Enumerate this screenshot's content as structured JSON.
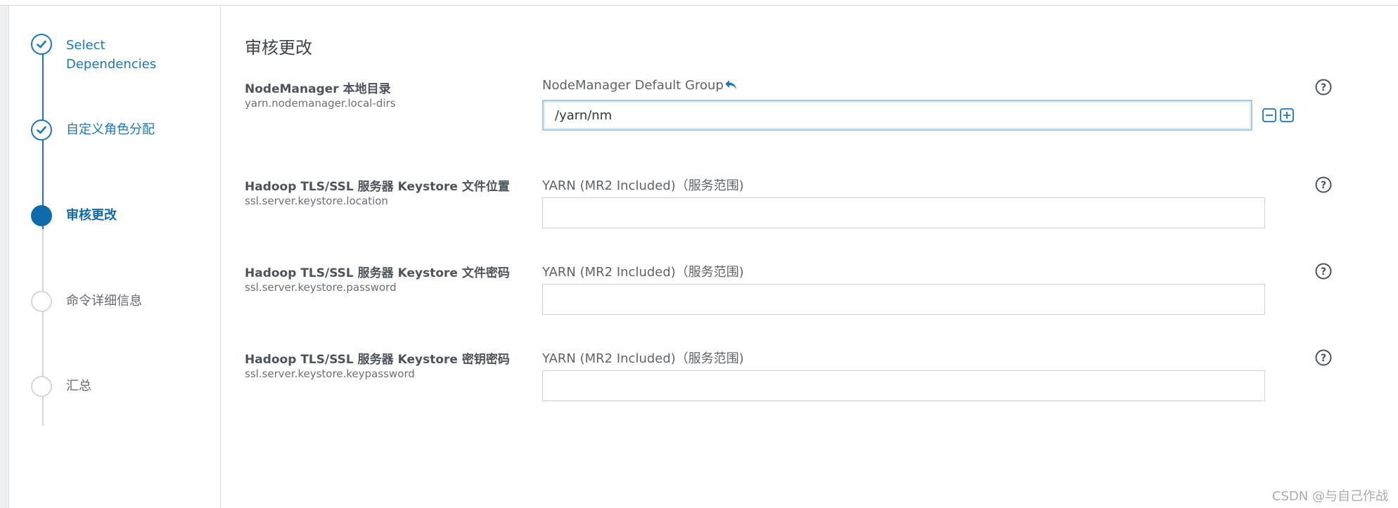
{
  "steps": [
    {
      "label_line1": "Select",
      "label_line2": "Dependencies",
      "state": "done"
    },
    {
      "label": "自定义角色分配",
      "state": "done"
    },
    {
      "label": "审核更改",
      "state": "active"
    },
    {
      "label": "命令详细信息",
      "state": "todo"
    },
    {
      "label": "汇总",
      "state": "todo"
    }
  ],
  "page": {
    "title": "审核更改"
  },
  "properties": [
    {
      "title": "NodeManager 本地目录",
      "key": "yarn.nodemanager.local-dirs",
      "scope": "NodeManager Default Group",
      "value": "/yarn/nm",
      "placeholder": ""
    },
    {
      "title": "Hadoop TLS/SSL 服务器 Keystore 文件位置",
      "key": "ssl.server.keystore.location",
      "scope": "YARN (MR2 Included)（服务范围)",
      "value": "",
      "placeholder": ""
    },
    {
      "title": "Hadoop TLS/SSL 服务器 Keystore 文件密码",
      "key": "ssl.server.keystore.password",
      "scope": "YARN (MR2 Included)（服务范围)",
      "value": "",
      "placeholder": ""
    },
    {
      "title": "Hadoop TLS/SSL 服务器 Keystore 密钥密码",
      "key": "ssl.server.keystore.keypassword",
      "scope": "YARN (MR2 Included)（服务范围)",
      "value": "",
      "placeholder": ""
    }
  ],
  "icons": {
    "check": "check-icon",
    "undo": "undo-arrow-icon",
    "remove": "minus-square-icon",
    "add": "plus-square-icon",
    "help": "question-circle-icon"
  },
  "colors": {
    "accent": "#0e6bac",
    "done": "#1a78b8",
    "inactive": "#d4d7db"
  },
  "watermark": "CSDN @与自己作战"
}
